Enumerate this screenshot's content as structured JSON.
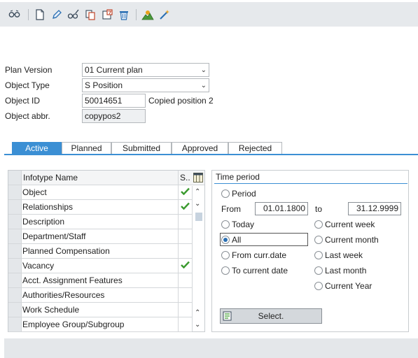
{
  "toolbar": {
    "icons": [
      "glasses-icon",
      "new-document-icon",
      "pencil-icon",
      "glasses-edit-icon",
      "copy-icon",
      "calendar-icon",
      "trash-icon",
      "mountain-icon",
      "magic-wand-icon"
    ]
  },
  "header": {
    "plan_version_label": "Plan Version",
    "plan_version_value": "01 Current plan",
    "object_type_label": "Object Type",
    "object_type_value": "S Position",
    "object_id_label": "Object ID",
    "object_id_value": "50014651",
    "object_id_desc": "Copied position 2",
    "object_abbr_label": "Object abbr.",
    "object_abbr_value": "copypos2"
  },
  "tabs": [
    {
      "label": "Active",
      "active": true
    },
    {
      "label": "Planned",
      "active": false
    },
    {
      "label": "Submitted",
      "active": false
    },
    {
      "label": "Approved",
      "active": false
    },
    {
      "label": "Rejected",
      "active": false
    }
  ],
  "infotypes": {
    "col_name": "Infotype Name",
    "col_status": "S..",
    "rows": [
      {
        "name": "Object",
        "checked": true
      },
      {
        "name": "Relationships",
        "checked": true
      },
      {
        "name": "Description",
        "checked": false
      },
      {
        "name": "Department/Staff",
        "checked": false
      },
      {
        "name": "Planned Compensation",
        "checked": false
      },
      {
        "name": "Vacancy",
        "checked": true
      },
      {
        "name": "Acct. Assignment Features",
        "checked": false
      },
      {
        "name": "Authorities/Resources",
        "checked": false
      },
      {
        "name": "Work Schedule",
        "checked": false
      },
      {
        "name": "Employee Group/Subgroup",
        "checked": false
      }
    ]
  },
  "time_period": {
    "title": "Time period",
    "period_label": "Period",
    "from_label": "From",
    "from_value": "01.01.1800",
    "to_label": "to",
    "to_value": "31.12.9999",
    "today": "Today",
    "all": "All",
    "from_curr": "From curr.date",
    "to_current": "To current date",
    "current_week": "Current week",
    "current_month": "Current month",
    "last_week": "Last week",
    "last_month": "Last month",
    "current_year": "Current Year",
    "selected": "All",
    "select_button": "Select."
  },
  "colors": {
    "accent": "#3b8fd4",
    "check": "#3a9a2e"
  }
}
